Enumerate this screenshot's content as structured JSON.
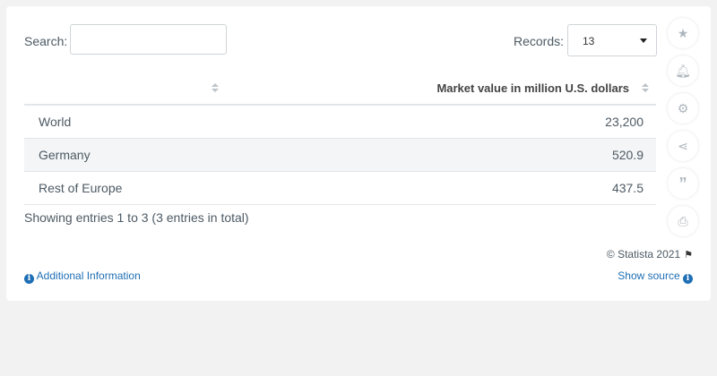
{
  "search": {
    "label": "Search:",
    "value": ""
  },
  "records": {
    "label": "Records:",
    "value": "13"
  },
  "table": {
    "columns": [
      "",
      "Market value in million U.S. dollars"
    ],
    "rows": [
      {
        "name": "World",
        "value": "23,200"
      },
      {
        "name": "Germany",
        "value": "520.9"
      },
      {
        "name": "Rest of Europe",
        "value": "437.5"
      }
    ]
  },
  "footer": {
    "showing": "Showing entries 1 to 3 (3 entries in total)",
    "copyright": "© Statista 2021",
    "additional_info": "Additional Information",
    "show_source": "Show source"
  },
  "sidebar_icons": [
    "star-icon",
    "bell-icon",
    "gear-icon",
    "share-icon",
    "quote-icon",
    "print-icon"
  ]
}
